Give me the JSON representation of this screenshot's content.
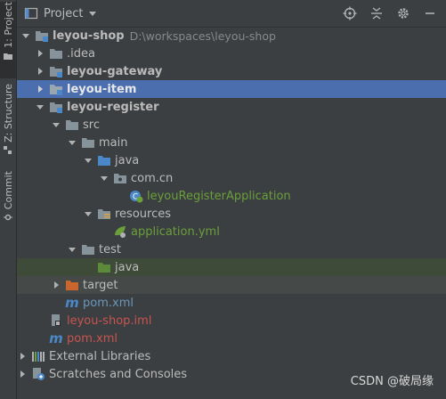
{
  "stripe": {
    "project_tab": "1: Project",
    "structure_tab": "Z: Structure",
    "commit_tab": "Commit"
  },
  "header": {
    "title": "Project"
  },
  "tree": {
    "root": {
      "label": "leyou-shop",
      "path": "D:\\workspaces\\leyou-shop"
    },
    "idea": ".idea",
    "gateway": "leyou-gateway",
    "item": "leyou-item",
    "register": "leyou-register",
    "src": "src",
    "main": "main",
    "java": "java",
    "package": "com.cn",
    "app_class": "leyouRegisterApplication",
    "resources": "resources",
    "app_yml": "application.yml",
    "test": "test",
    "test_java": "java",
    "target": "target",
    "pom_module": "pom.xml",
    "iml": "leyou-shop.iml",
    "pom_root": "pom.xml",
    "external": "External Libraries",
    "scratches": "Scratches and Consoles"
  },
  "watermark": "CSDN @破局缘",
  "colors": {
    "background": "#3c3f41",
    "selection": "#4b6eaf",
    "folder_blue": "#4a88c7",
    "maven_blue": "#4a88c7",
    "excluded_orange": "#c9662d",
    "test_green": "#5a8a3a",
    "error_red": "#c75450"
  }
}
